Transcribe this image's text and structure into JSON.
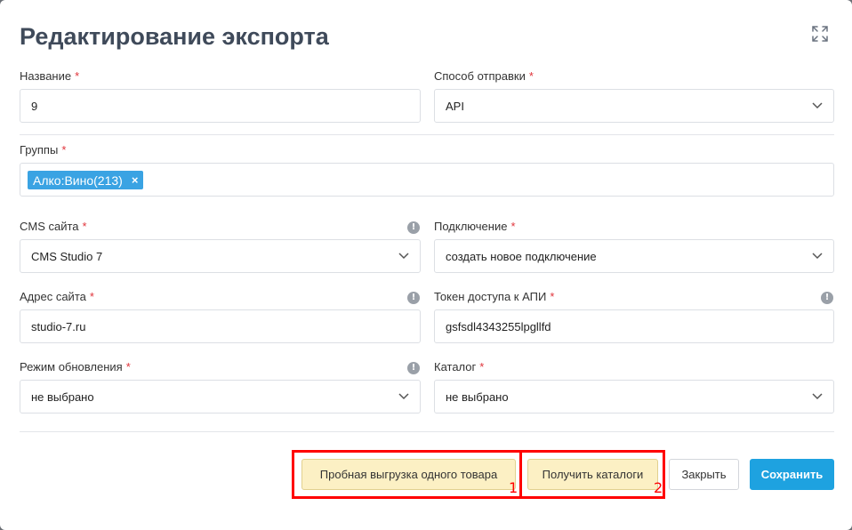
{
  "dialog": {
    "title": "Редактирование экспорта"
  },
  "required_mark": "*",
  "info_glyph": "!",
  "fields": {
    "name": {
      "label": "Название",
      "value": "9"
    },
    "send_method": {
      "label": "Способ отправки",
      "value": "API"
    },
    "groups": {
      "label": "Группы",
      "tags": [
        {
          "label": "Алко:Вино(213)",
          "remove": "×"
        }
      ]
    },
    "cms": {
      "label": "CMS сайта",
      "value": "CMS Studio 7"
    },
    "connection": {
      "label": "Подключение",
      "value": "создать новое подключение"
    },
    "site_address": {
      "label": "Адрес сайта",
      "value": "studio-7.ru"
    },
    "api_token": {
      "label": "Токен доступа к АПИ",
      "value": "gsfsdl4343255lpgllfd"
    },
    "update_mode": {
      "label": "Режим обновления",
      "value": "не выбрано"
    },
    "catalog": {
      "label": "Каталог",
      "value": "не выбрано"
    }
  },
  "footer": {
    "test_export_label": "Пробная выгрузка одного товара",
    "get_catalogs_label": "Получить каталоги",
    "close_label": "Закрыть",
    "save_label": "Сохранить"
  },
  "annotations": {
    "box1_number": "1",
    "box2_number": "2",
    "color": "#ff0000"
  },
  "icons": {
    "expand": "expand-icon",
    "chevron": "chevron-down-icon",
    "info": "info-icon"
  }
}
